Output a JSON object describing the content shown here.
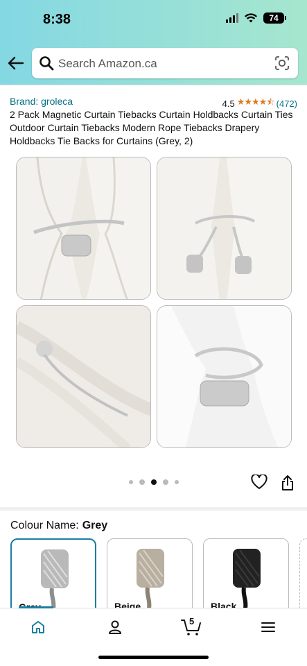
{
  "status_bar": {
    "time": "8:38",
    "battery": "74"
  },
  "search": {
    "placeholder": "Search Amazon.ca"
  },
  "product": {
    "brand": "Brand: groleca",
    "rating": "4.5",
    "rating_count": "(472)",
    "stars": "★★★★⯪",
    "title": "2 Pack Magnetic Curtain Tiebacks Curtain Holdbacks Curtain Ties Outdoor Curtain Tiebacks Modern Rope Tiebacks Drapery Holdbacks Tie Backs for Curtains (Grey, 2)"
  },
  "gallery": {
    "image_count": 5,
    "active_index": 2
  },
  "colour": {
    "label": "Colour Name:",
    "selected": "Grey",
    "options": [
      {
        "name": "Grey",
        "color": "#b9b9b9"
      },
      {
        "name": "Beige",
        "color": "#b8afa0"
      },
      {
        "name": "Black",
        "color": "#222222"
      }
    ]
  },
  "nav": {
    "cart_count": "5"
  },
  "colors": {
    "link": "#007185",
    "star": "#de7921",
    "accent": "#1a7fa0"
  }
}
